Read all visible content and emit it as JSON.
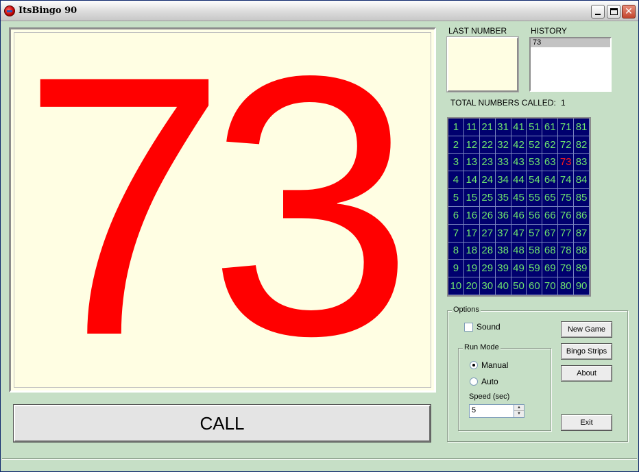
{
  "window": {
    "title": "ItsBingo 90"
  },
  "display": {
    "current_number": "73",
    "color": "#ff0000"
  },
  "call_button": {
    "label": "CALL"
  },
  "last_number": {
    "label": "LAST NUMBER",
    "value": ""
  },
  "history": {
    "label": "HISTORY",
    "items": [
      "73"
    ]
  },
  "total_called": {
    "label": "TOTAL NUMBERS CALLED:",
    "value": "1"
  },
  "board": {
    "rows": [
      [
        "1",
        "11",
        "21",
        "31",
        "41",
        "51",
        "61",
        "71",
        "81"
      ],
      [
        "2",
        "12",
        "22",
        "32",
        "42",
        "52",
        "62",
        "72",
        "82"
      ],
      [
        "3",
        "13",
        "23",
        "33",
        "43",
        "53",
        "63",
        "73",
        "83"
      ],
      [
        "4",
        "14",
        "24",
        "34",
        "44",
        "54",
        "64",
        "74",
        "84"
      ],
      [
        "5",
        "15",
        "25",
        "35",
        "45",
        "55",
        "65",
        "75",
        "85"
      ],
      [
        "6",
        "16",
        "26",
        "36",
        "46",
        "56",
        "66",
        "76",
        "86"
      ],
      [
        "7",
        "17",
        "27",
        "37",
        "47",
        "57",
        "67",
        "77",
        "87"
      ],
      [
        "8",
        "18",
        "28",
        "38",
        "48",
        "58",
        "68",
        "78",
        "88"
      ],
      [
        "9",
        "19",
        "29",
        "39",
        "49",
        "59",
        "69",
        "79",
        "89"
      ],
      [
        "10",
        "20",
        "30",
        "40",
        "50",
        "60",
        "70",
        "80",
        "90"
      ]
    ],
    "called": [
      "73"
    ],
    "colors": {
      "background": "#00006e",
      "number": "#6ee26e",
      "called": "#ff1a1a"
    }
  },
  "options": {
    "title": "Options",
    "sound": {
      "label": "Sound",
      "checked": false
    },
    "run_mode": {
      "title": "Run Mode",
      "manual": {
        "label": "Manual",
        "selected": true
      },
      "auto": {
        "label": "Auto",
        "selected": false
      }
    },
    "speed": {
      "label": "Speed (sec)",
      "value": "5"
    },
    "buttons": {
      "new_game": "New Game",
      "bingo_strips": "Bingo Strips",
      "about": "About",
      "exit": "Exit"
    }
  }
}
